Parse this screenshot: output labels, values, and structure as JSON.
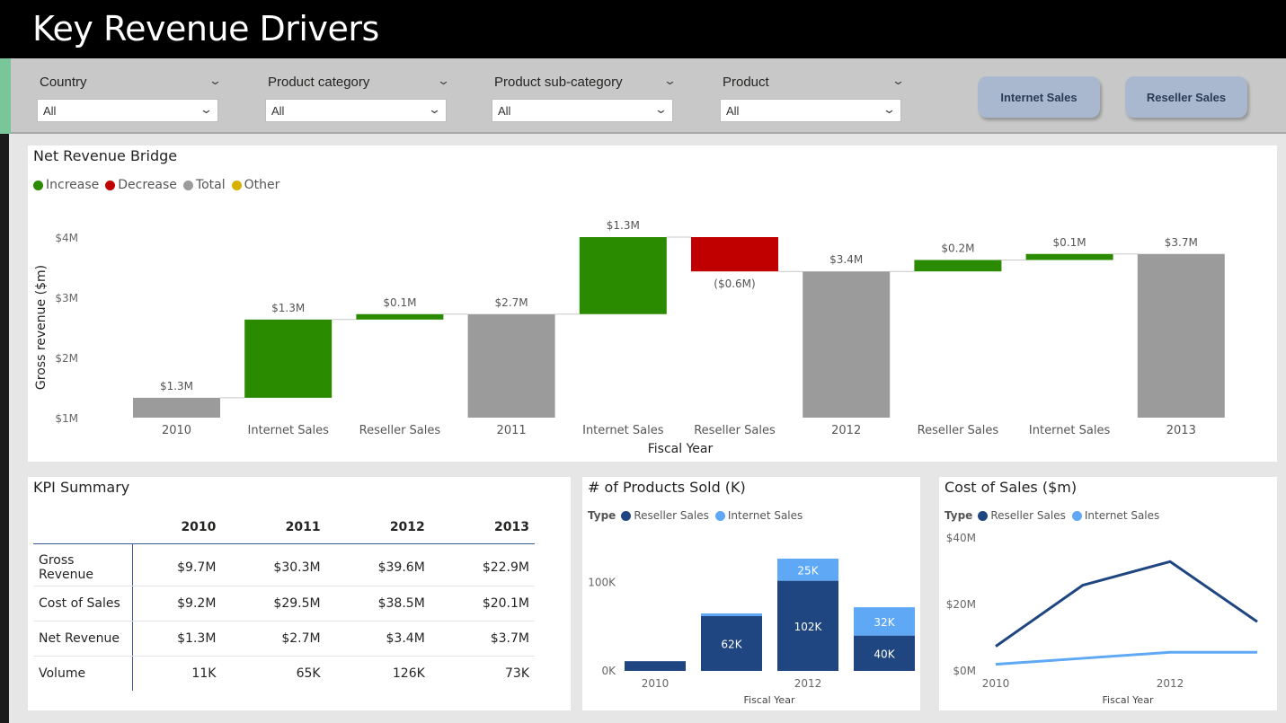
{
  "header": {
    "title": "Key Revenue Drivers"
  },
  "filters": [
    {
      "label": "Country",
      "value": "All"
    },
    {
      "label": "Product category",
      "value": "All"
    },
    {
      "label": "Product sub-category",
      "value": "All"
    },
    {
      "label": "Product",
      "value": "All"
    }
  ],
  "buttons": {
    "internet": "Internet Sales",
    "reseller": "Reseller Sales"
  },
  "colors": {
    "increase": "#2a8a00",
    "decrease": "#c00000",
    "total": "#9b9b9b",
    "other": "#d6b100",
    "reseller": "#1f4680",
    "internet": "#5ea8f5"
  },
  "bridge": {
    "title": "Net Revenue Bridge",
    "legend": [
      "Increase",
      "Decrease",
      "Total",
      "Other"
    ]
  },
  "kpi": {
    "title": "KPI Summary",
    "years": [
      "2010",
      "2011",
      "2012",
      "2013"
    ],
    "rows": [
      {
        "label": "Gross Revenue",
        "values": [
          "$9.7M",
          "$30.3M",
          "$39.6M",
          "$22.9M"
        ]
      },
      {
        "label": "Cost of Sales",
        "values": [
          "$9.2M",
          "$29.5M",
          "$38.5M",
          "$20.1M"
        ]
      },
      {
        "label": "Net Revenue",
        "values": [
          "$1.3M",
          "$2.7M",
          "$3.4M",
          "$3.7M"
        ]
      },
      {
        "label": "Volume",
        "values": [
          "11K",
          "65K",
          "126K",
          "73K"
        ]
      }
    ]
  },
  "products": {
    "title": "# of Products Sold (K)",
    "legend_title": "Type",
    "legend": [
      "Reseller Sales",
      "Internet Sales"
    ]
  },
  "cost": {
    "title": "Cost of Sales ($m)",
    "legend_title": "Type",
    "legend": [
      "Reseller Sales",
      "Internet Sales"
    ]
  },
  "chart_data": [
    {
      "type": "bar",
      "subtype": "waterfall",
      "title": "Net Revenue Bridge",
      "xlabel": "Fiscal Year",
      "ylabel": "Gross revenue ($m)",
      "ylim": [
        1,
        4
      ],
      "yticks": [
        "$1M",
        "$2M",
        "$3M",
        "$4M"
      ],
      "categories": [
        "2010",
        "Internet Sales",
        "Reseller Sales",
        "2011",
        "Internet Sales",
        "Reseller Sales",
        "2012",
        "Reseller Sales",
        "Internet Sales",
        "2013"
      ],
      "start": [
        1.0,
        1.33,
        2.63,
        1.0,
        2.72,
        4.0,
        1.0,
        3.43,
        3.62,
        1.0
      ],
      "end": [
        1.33,
        2.63,
        2.72,
        2.72,
        4.0,
        3.43,
        3.43,
        3.62,
        3.72,
        3.72
      ],
      "kinds": [
        "total",
        "increase",
        "increase",
        "total",
        "increase",
        "decrease",
        "total",
        "increase",
        "increase",
        "total"
      ],
      "labels": [
        "$1.3M",
        "$1.3M",
        "$0.1M",
        "$2.7M",
        "$1.3M",
        "($0.6M)",
        "$3.4M",
        "$0.2M",
        "$0.1M",
        "$3.7M"
      ],
      "legend": [
        "Increase",
        "Decrease",
        "Total",
        "Other"
      ],
      "legend_position": "top-left",
      "grid": false
    },
    {
      "type": "bar",
      "subtype": "stacked",
      "title": "# of Products Sold (K)",
      "xlabel": "Fiscal Year",
      "categories": [
        "2010",
        "2011",
        "2012",
        "2013"
      ],
      "xtick_labels": [
        "2010",
        "",
        "2012",
        ""
      ],
      "ylim": [
        0,
        126
      ],
      "yticks": [
        "0K",
        "100K"
      ],
      "series": [
        {
          "name": "Reseller Sales",
          "values": [
            11,
            62,
            102,
            40
          ],
          "labels": [
            "",
            "62K",
            "102K",
            "40K"
          ]
        },
        {
          "name": "Internet Sales",
          "values": [
            0,
            3,
            25,
            32
          ],
          "labels": [
            "",
            "",
            "25K",
            "32K"
          ]
        }
      ],
      "legend_title": "Type",
      "legend_position": "top-left",
      "grid": false
    },
    {
      "type": "line",
      "title": "Cost of Sales ($m)",
      "xlabel": "Fiscal Year",
      "x": [
        "2010",
        "2011",
        "2012",
        "2013"
      ],
      "xtick_labels": [
        "2010",
        "",
        "2012",
        ""
      ],
      "ylim": [
        0,
        40
      ],
      "yticks": [
        "$0M",
        "$20M",
        "$40M"
      ],
      "series": [
        {
          "name": "Reseller Sales",
          "values": [
            7.4,
            25.8,
            32.9,
            14.8
          ]
        },
        {
          "name": "Internet Sales",
          "values": [
            2.0,
            3.8,
            5.6,
            5.6
          ]
        }
      ],
      "legend_title": "Type",
      "legend_position": "top-left",
      "grid": false
    }
  ]
}
